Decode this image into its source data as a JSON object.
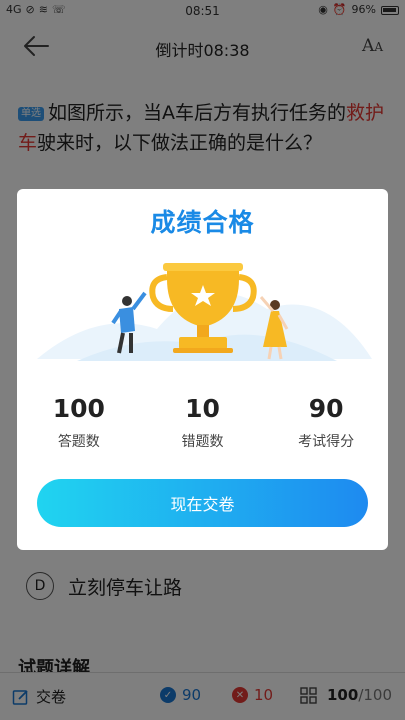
{
  "status_bar": {
    "carrier": "4G",
    "time": "08:51",
    "battery": "96%"
  },
  "header": {
    "title": "倒计时08:38"
  },
  "question": {
    "type_badge": "单选",
    "text_part1": "如图所示，当A车后方有执行任务的",
    "text_highlight": "救护车",
    "text_part2": "驶来时，以下做法正确的是什么？"
  },
  "option_d": {
    "letter": "D",
    "text": "立刻停车让路"
  },
  "explain_title": "试题详解",
  "bottom_bar": {
    "submit_label": "交卷",
    "correct_count": "90",
    "wrong_count": "10",
    "answered": "100",
    "total": "/100"
  },
  "result_modal": {
    "title": "成绩合格",
    "stats": [
      {
        "value": "100",
        "label": "答题数"
      },
      {
        "value": "10",
        "label": "错题数"
      },
      {
        "value": "90",
        "label": "考试得分"
      }
    ],
    "submit_button": "现在交卷"
  },
  "colors": {
    "accent": "#1a8ae6",
    "highlight": "#e53935",
    "trophy": "#f7b924"
  }
}
